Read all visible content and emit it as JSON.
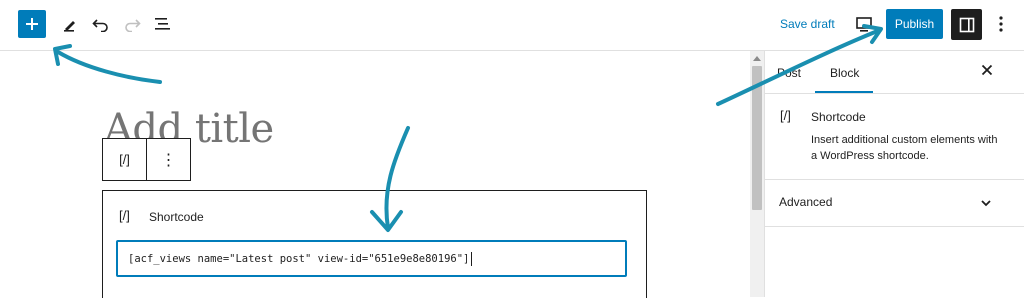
{
  "toolbar": {
    "add_icon": "plus-icon",
    "tools_icon": "pencil-icon",
    "undo_icon": "undo-icon",
    "redo_icon": "redo-icon",
    "list_view_icon": "list-view-icon",
    "save_draft": "Save draft",
    "publish": "Publish",
    "accent": "#007cba"
  },
  "editor": {
    "title_placeholder": "Add title",
    "block_toolbar_icon": "[/]",
    "block_toolbar_more": "⋮",
    "shortcode_block": {
      "icon": "[/]",
      "label": "Shortcode",
      "value": "[acf_views name=\"Latest post\" view-id=\"651e9e8e80196\"]"
    }
  },
  "sidebar": {
    "tabs": [
      "Post",
      "Block"
    ],
    "active_tab": "Block",
    "block_card": {
      "icon": "[/]",
      "name": "Shortcode",
      "description": "Insert additional custom elements with a WordPress shortcode."
    },
    "panels": [
      {
        "label": "Advanced",
        "expanded": false
      }
    ]
  },
  "annotation_color": "#1a8fb0"
}
